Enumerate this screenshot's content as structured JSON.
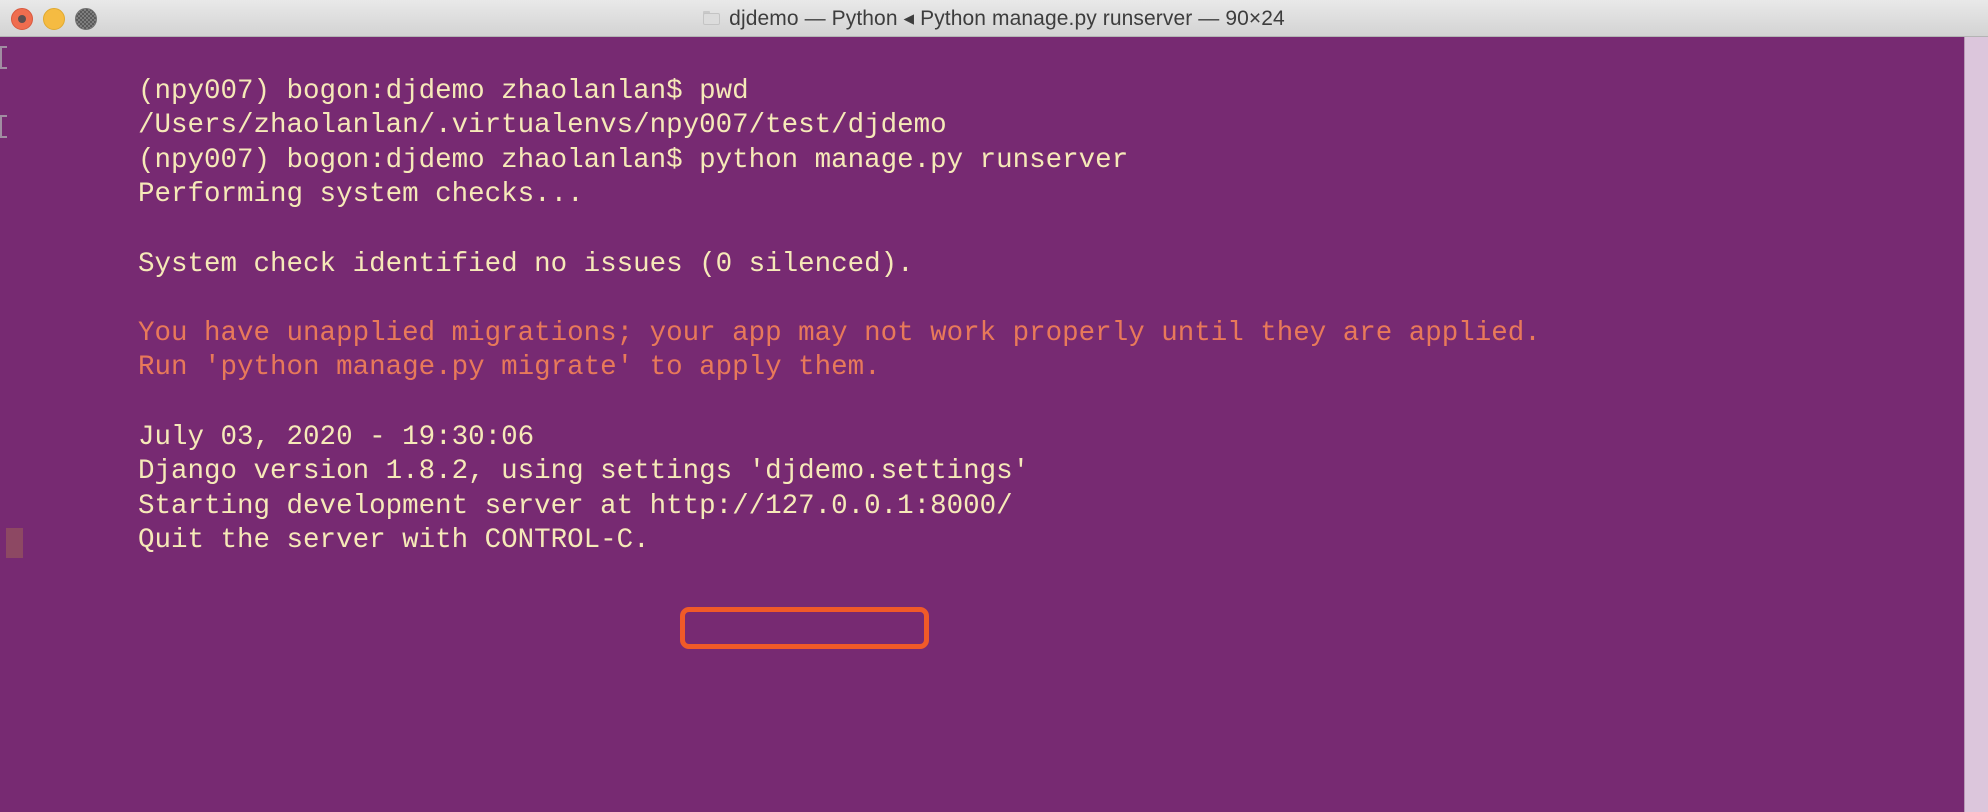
{
  "window": {
    "title": "djdemo — Python ◂ Python manage.py runserver — 90×24",
    "cols_rows": "90×24",
    "app": "Terminal",
    "background_color": "#772A72",
    "text_color": "#F6E9B8",
    "warning_color": "#E8795A",
    "annotation_color": "#F05A28"
  },
  "titlebar": {
    "close_label": "Close",
    "minimize_label": "Minimize",
    "zoom_label": "Zoom",
    "folder_icon": "folder-icon"
  },
  "terminal": {
    "lines": [
      {
        "text": "(npy007) bogon:djdemo zhaolanlan$ pwd",
        "kind": "prompt"
      },
      {
        "text": "/Users/zhaolanlan/.virtualenvs/npy007/test/djdemo",
        "kind": "output"
      },
      {
        "text": "(npy007) bogon:djdemo zhaolanlan$ python manage.py runserver",
        "kind": "prompt"
      },
      {
        "text": "Performing system checks...",
        "kind": "output"
      },
      {
        "text": "",
        "kind": "blank"
      },
      {
        "text": "System check identified no issues (0 silenced).",
        "kind": "output"
      },
      {
        "text": "",
        "kind": "blank"
      },
      {
        "text": "You have unapplied migrations; your app may not work properly until they are applied.",
        "kind": "warning"
      },
      {
        "text": "Run 'python manage.py migrate' to apply them.",
        "kind": "warning"
      },
      {
        "text": "",
        "kind": "blank"
      },
      {
        "text": "July 03, 2020 - 19:30:06",
        "kind": "output"
      },
      {
        "text": "Django version 1.8.2, using settings 'djdemo.settings'",
        "kind": "output"
      },
      {
        "text": "Starting development server at http://127.0.0.1:8000/",
        "kind": "output"
      },
      {
        "text": "Quit the server with CONTROL-C.",
        "kind": "output"
      }
    ],
    "highlighted_url": "http://127.0.0.1:8000/",
    "cursor_visible": true
  }
}
